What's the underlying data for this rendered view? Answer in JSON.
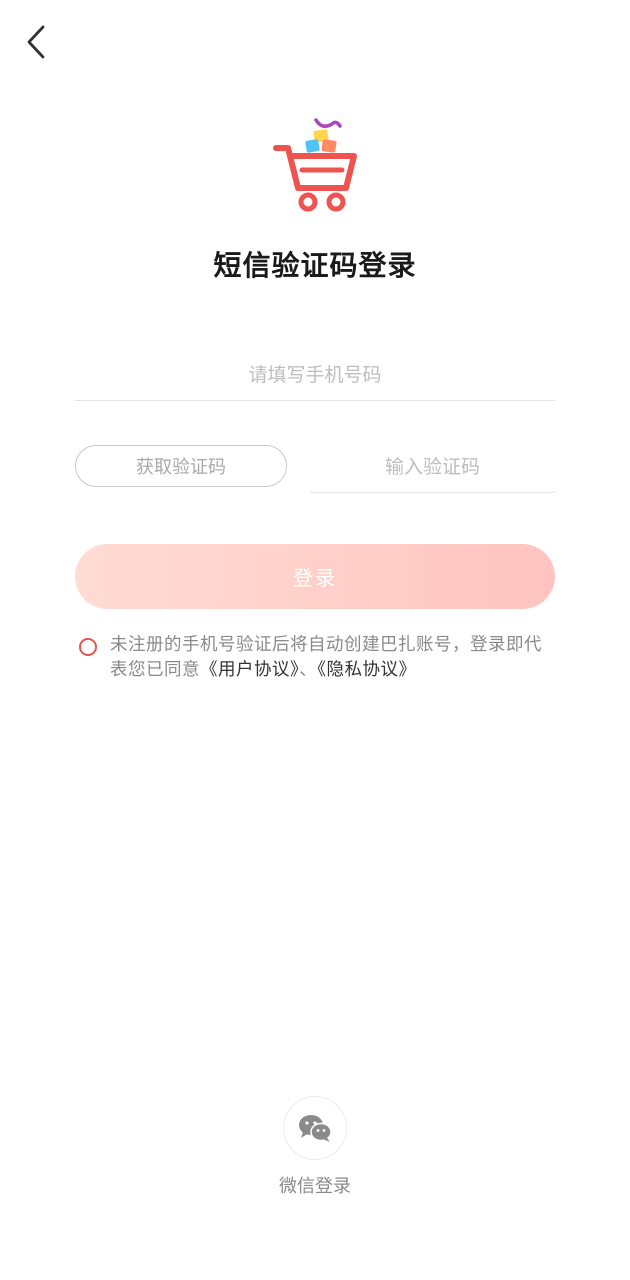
{
  "header": {
    "back_icon": "chevron-left-icon"
  },
  "logo": {
    "icon": "shopping-cart-logo-icon",
    "colors": {
      "cart": "#ef5350",
      "box_yellow": "#ffd54f",
      "box_blue": "#4fc3f7",
      "box_orange": "#ff8a65",
      "ribbon": "#ab47bc"
    }
  },
  "title": "短信验证码登录",
  "phone": {
    "placeholder": "请填写手机号码",
    "value": ""
  },
  "code": {
    "get_code_label": "获取验证码",
    "placeholder": "输入验证码",
    "value": ""
  },
  "login_button": {
    "label": "登录",
    "gradient_start": "#ffdcd4",
    "gradient_end": "#ffc4c0"
  },
  "agreement": {
    "checked": false,
    "text_prefix": "未注册的手机号验证后将自动创建巴扎账号，登录即代表您已同意",
    "user_agreement": "《用户协议》",
    "separator": "、",
    "privacy_policy": "《隐私协议》"
  },
  "wechat_login": {
    "icon": "wechat-icon",
    "label": "微信登录"
  }
}
